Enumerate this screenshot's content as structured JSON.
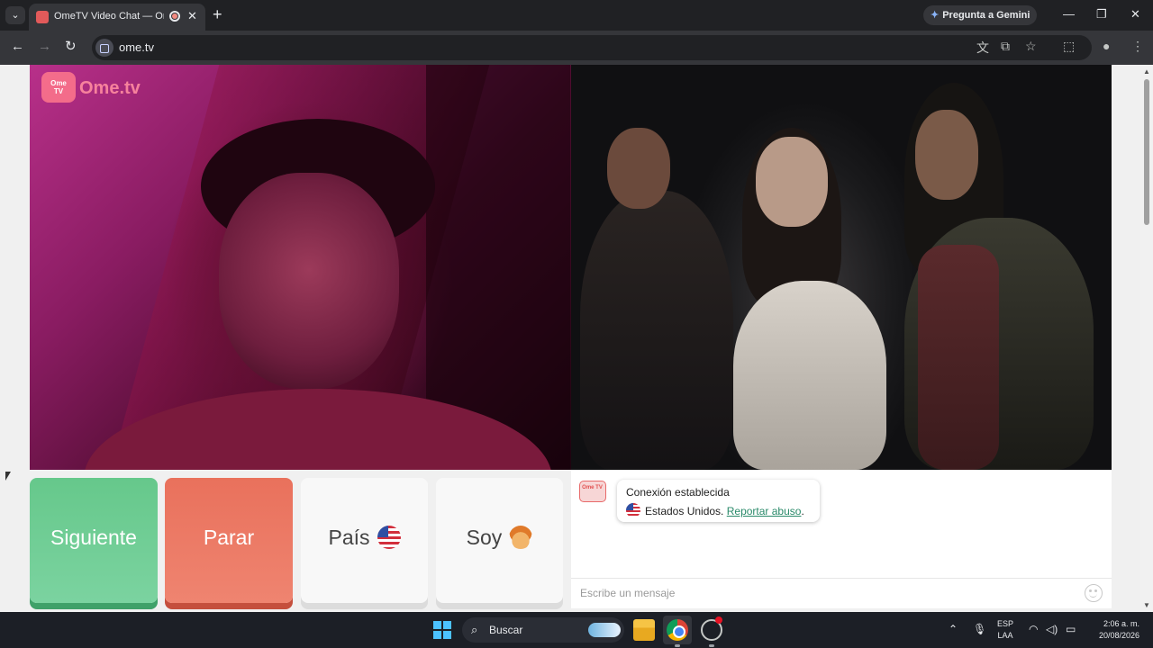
{
  "browser": {
    "tab": {
      "title": "OmeTV Video Chat — Ome"
    },
    "url": "ome.tv",
    "gemini_label": "Pregunta a Gemini"
  },
  "logo": {
    "box_text": "Ome TV",
    "text": "Ome.tv"
  },
  "controls": {
    "next_label": "Siguiente",
    "stop_label": "Parar",
    "country_label": "País",
    "gender_label": "Soy"
  },
  "chat": {
    "logo_text": "Ome TV",
    "status": "Conexión establecida",
    "country": "Estados Unidos.",
    "report_link": "Reportar abuso",
    "report_suffix": ".",
    "input_placeholder": "Escribe un mensaje"
  },
  "taskbar": {
    "search_label": "Buscar",
    "lang_line1": "ESP",
    "lang_line2": "LAA",
    "time": "2:06 a. m.",
    "date": "20/08/2026"
  },
  "colors": {
    "next": "#6fcd95",
    "stop": "#ec7b65",
    "link": "#2a8a6a"
  }
}
